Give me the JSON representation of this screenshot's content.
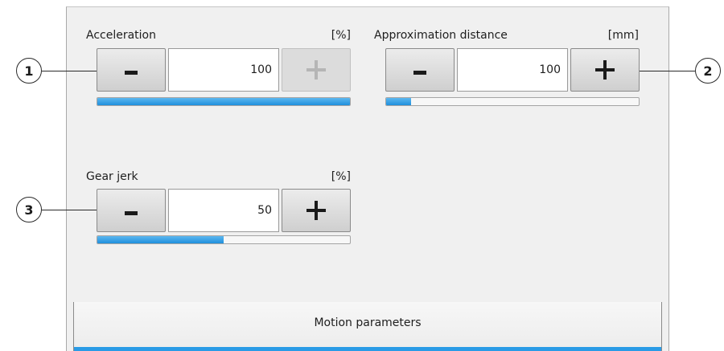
{
  "acceleration": {
    "label": "Acceleration",
    "unit": "[%]",
    "value": "100",
    "minus_label": "-",
    "plus_label": "+",
    "plus_enabled": false,
    "level_percent": 100
  },
  "approximation_distance": {
    "label": "Approximation distance",
    "unit": "[mm]",
    "value": "100",
    "minus_label": "-",
    "plus_label": "+",
    "level_percent": 10
  },
  "gear_jerk": {
    "label": "Gear jerk",
    "unit": "[%]",
    "value": "50",
    "minus_label": "-",
    "plus_label": "+",
    "level_percent": 50
  },
  "callouts": {
    "one": "1",
    "two": "2",
    "three": "3"
  },
  "tab": {
    "label": "Motion parameters"
  },
  "colors": {
    "accent": "#2a9be6",
    "panel": "#f0f0f0"
  }
}
